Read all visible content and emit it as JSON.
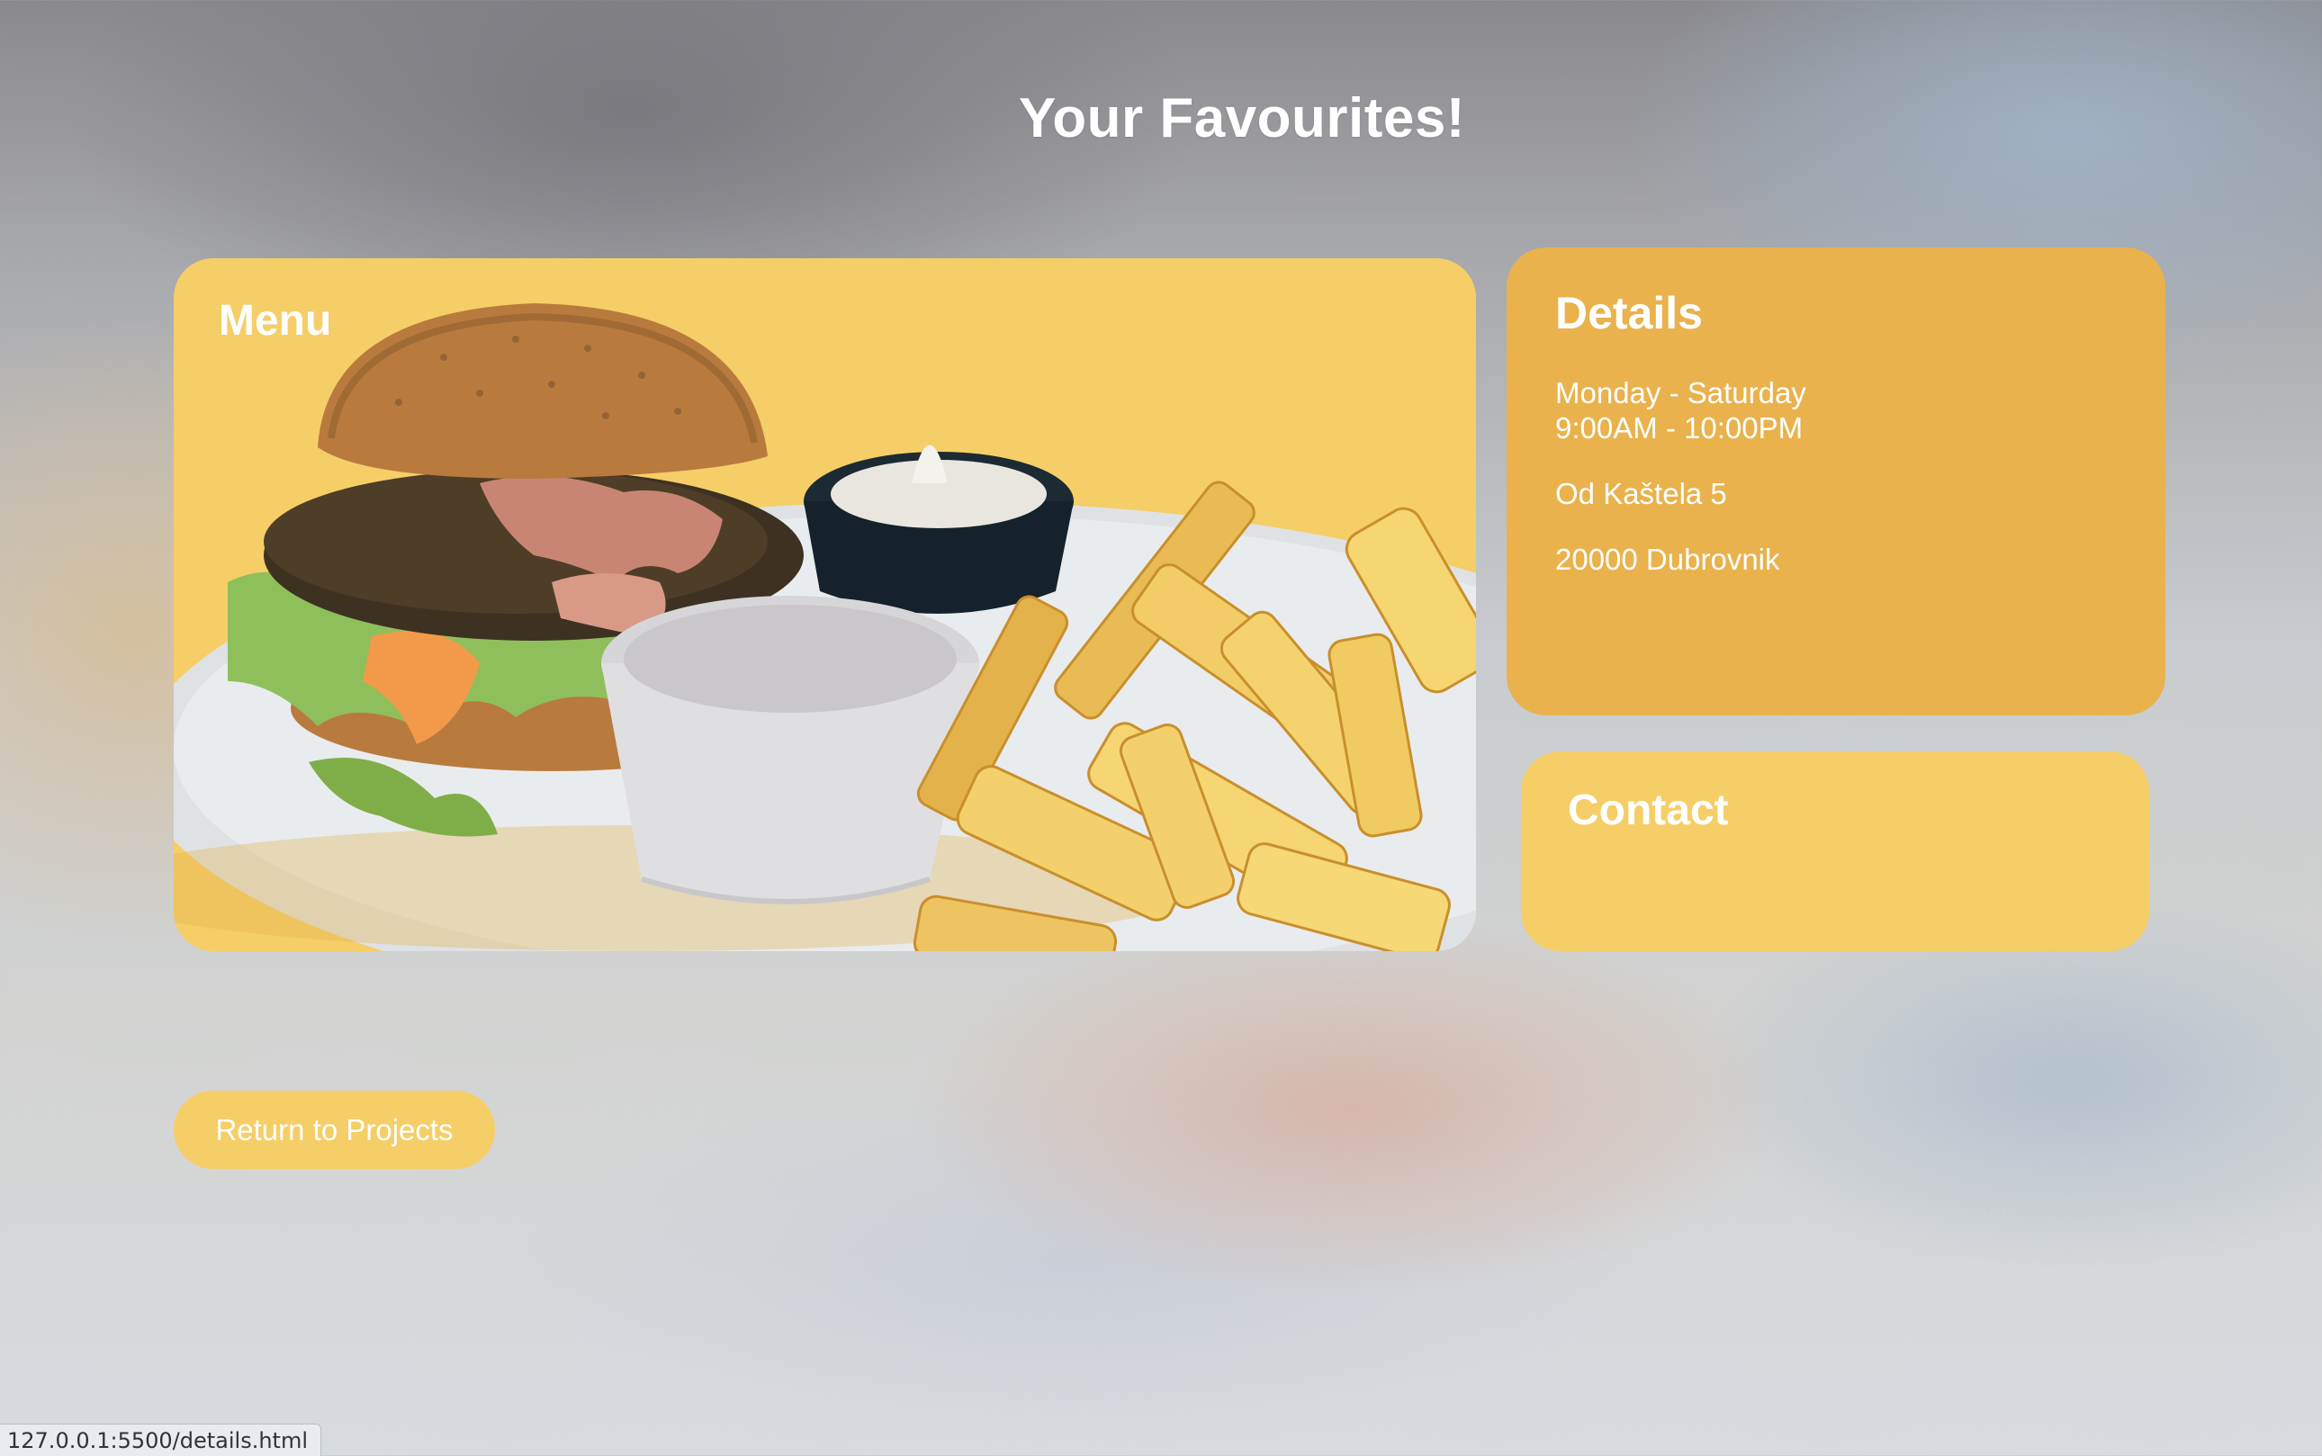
{
  "page": {
    "title": "Your Favourites!"
  },
  "menu_card": {
    "title": "Menu",
    "image_alt": "burger and fries"
  },
  "details_card": {
    "title": "Details",
    "hours_days": "Monday - Saturday",
    "hours_time": "9:00AM - 10:00PM",
    "street": "Od Kaštela 5",
    "city": "20000 Dubrovnik"
  },
  "contact_card": {
    "title": "Contact"
  },
  "return_button": {
    "label": "Return to Projects"
  },
  "status_bar": {
    "url": "127.0.0.1:5500/details.html"
  },
  "colors": {
    "card_yellow": "#f6ce67",
    "card_amber": "#e9b24c",
    "text": "#ffffff"
  }
}
